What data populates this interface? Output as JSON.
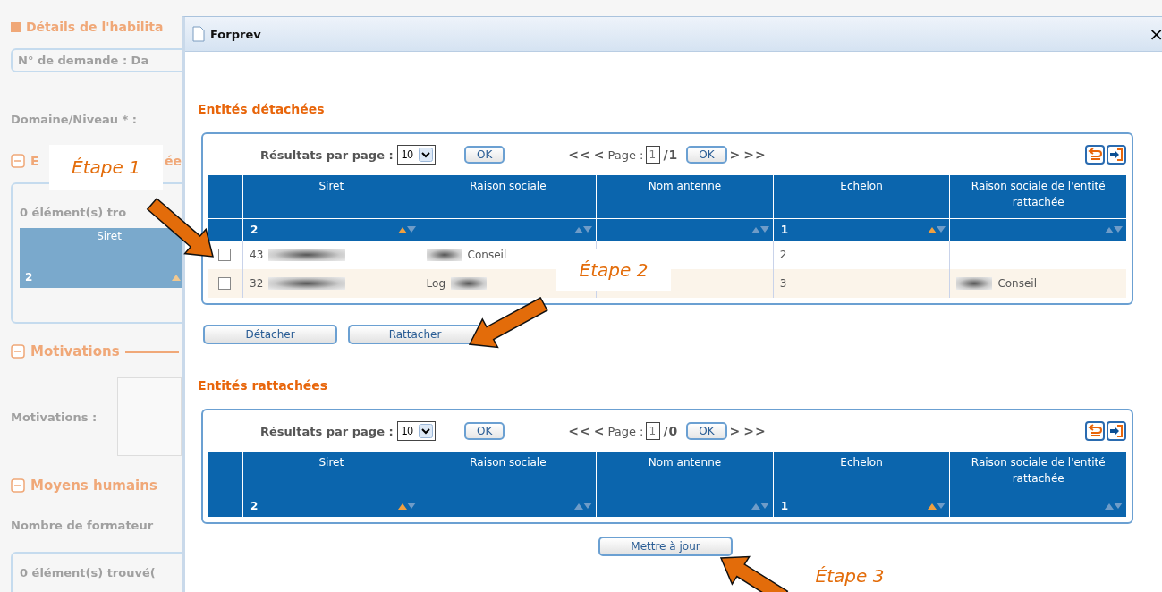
{
  "background_page": {
    "title": "Détails de l'habilita",
    "request_field": "N° de demande  :  Da",
    "domain_label": "Domaine/Niveau *  :",
    "section_1": {
      "title_start": "E",
      "title_end": "ée",
      "count": "0 élément(s) tro",
      "column": "Siret",
      "filter": "2"
    },
    "section_2": {
      "title": "Motivations",
      "field_label": "Motivations  :"
    },
    "section_3": {
      "title": "Moyens humains",
      "field_label": "Nombre de formateur",
      "count": "0 élément(s) trouvé("
    }
  },
  "dialog": {
    "title": "Forprev",
    "close": "×",
    "sections": [
      {
        "title": "Entités détachées",
        "per_page_label": "Résultats par page :",
        "per_page": "10",
        "ok": "OK",
        "pager": {
          "first": "<<",
          "prev": "<",
          "page_label": "Page :",
          "page": "1",
          "total": "/1",
          "ok": "OK",
          "next": ">",
          "last": ">>"
        },
        "columns": [
          {
            "label": "Siret",
            "filter": "2",
            "sorted_ascending": true
          },
          {
            "label": "Raison sociale",
            "sorted_ascending": false
          },
          {
            "label": "Nom antenne",
            "sorted_ascending": false
          },
          {
            "label": "Echelon",
            "filter": "1",
            "sorted_ascending": true
          },
          {
            "label": "Raison sociale de l'entité rattachée",
            "sorted_ascending": false
          }
        ],
        "rows": [
          {
            "checked": false,
            "cells": [
              {
                "text": "43",
                "blurred_after": true
              },
              {
                "text": "Conseil",
                "blurred_before": true
              },
              {},
              {
                "text": "2"
              },
              {}
            ]
          },
          {
            "checked": false,
            "cells": [
              {
                "text": "32",
                "blurred_after": true
              },
              {
                "text": "Log",
                "blurred_after": true
              },
              {},
              {
                "text": "3"
              },
              {
                "text": "Conseil",
                "blurred_before": true
              }
            ]
          }
        ]
      },
      {
        "title": "Entités rattachées",
        "per_page_label": "Résultats par page :",
        "per_page": "10",
        "ok": "OK",
        "pager": {
          "first": "<<",
          "prev": "<",
          "page_label": "Page :",
          "page": "1",
          "total": "/0",
          "ok": "OK",
          "next": ">",
          "last": ">>"
        },
        "columns": [
          {
            "label": "Siret",
            "filter": "2",
            "sorted_ascending": true
          },
          {
            "label": "Raison sociale",
            "sorted_ascending": false
          },
          {
            "label": "Nom antenne",
            "sorted_ascending": false
          },
          {
            "label": "Echelon",
            "filter": "1",
            "sorted_ascending": true
          },
          {
            "label": "Raison sociale de l'entité rattachée",
            "sorted_ascending": false
          }
        ]
      }
    ],
    "buttons": [
      "Détacher",
      "Rattacher"
    ],
    "update_button": "Mettre à jour"
  },
  "annotations": [
    {
      "label": "Étape 1"
    },
    {
      "label": "Étape 2"
    },
    {
      "label": "Étape 3"
    }
  ]
}
